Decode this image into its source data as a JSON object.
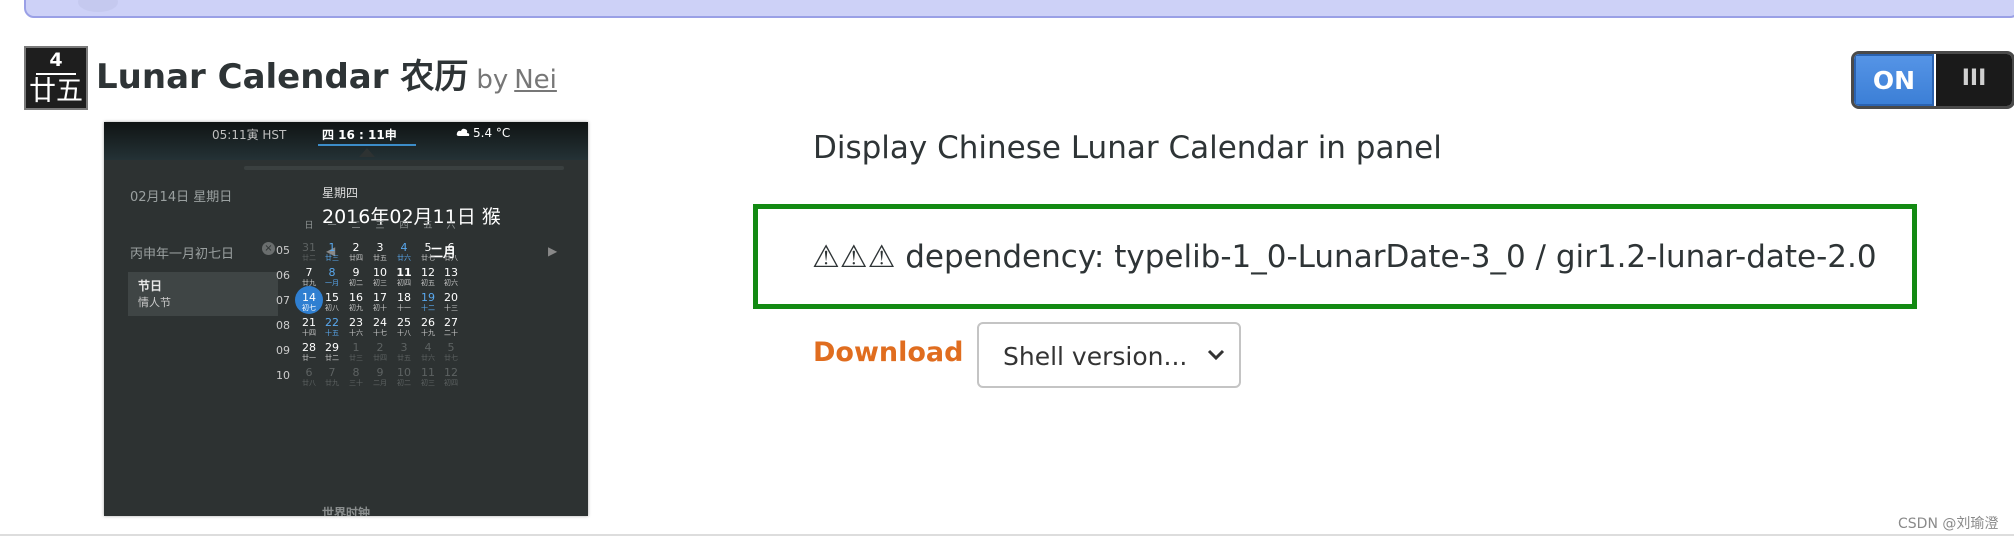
{
  "extension": {
    "icon": {
      "number": "4",
      "lunar_day": "廿五"
    },
    "title": "Lunar Calendar 农历",
    "by": "by",
    "author": "Nei",
    "toggle": {
      "state_label": "ON",
      "handle_glyph": "III",
      "enabled": true
    },
    "description": "Display Chinese Lunar Calendar in panel",
    "dependency": "⚠⚠⚠ dependency: typelib-1_0-LunarDate-3_0 / gir1.2-lunar-date-2.0",
    "download_label": "Download",
    "shell_version_placeholder": "Shell version..."
  },
  "screenshot": {
    "panel": {
      "time_hst": "05:11寅 HST",
      "clock": "四 16 : 11申",
      "weather": "5.4 °C"
    },
    "left_date": "02月14日 星期日",
    "lunar_date": "丙申年一月初七日",
    "close_glyph": "×",
    "festival": {
      "title": "节日",
      "item": "情人节"
    },
    "weekday": "星期四",
    "big_date": "2016年02月11日   猴",
    "nav_prev": "◀",
    "nav_next": "▶",
    "month": "二月",
    "weekday_headers": [
      "日",
      "一",
      "二",
      "三",
      "四",
      "五",
      "六"
    ],
    "weeks": [
      {
        "num": "05",
        "days": [
          {
            "d": "31",
            "l": "廿二",
            "dim": true
          },
          {
            "d": "1",
            "l": "廿三",
            "hl": true
          },
          {
            "d": "2",
            "l": "廿四"
          },
          {
            "d": "3",
            "l": "廿五"
          },
          {
            "d": "4",
            "l": "廿六",
            "hl": true
          },
          {
            "d": "5",
            "l": "廿七"
          },
          {
            "d": "6",
            "l": "廿八"
          }
        ]
      },
      {
        "num": "06",
        "days": [
          {
            "d": "7",
            "l": "廿九"
          },
          {
            "d": "8",
            "l": "一月",
            "hl": true
          },
          {
            "d": "9",
            "l": "初二"
          },
          {
            "d": "10",
            "l": "初三"
          },
          {
            "d": "11",
            "l": "初四",
            "bold": true
          },
          {
            "d": "12",
            "l": "初五"
          },
          {
            "d": "13",
            "l": "初六"
          }
        ]
      },
      {
        "num": "07",
        "days": [
          {
            "d": "14",
            "l": "初七",
            "today": true
          },
          {
            "d": "15",
            "l": "初八"
          },
          {
            "d": "16",
            "l": "初九"
          },
          {
            "d": "17",
            "l": "初十"
          },
          {
            "d": "18",
            "l": "十一"
          },
          {
            "d": "19",
            "l": "十二",
            "hl": true
          },
          {
            "d": "20",
            "l": "十三"
          }
        ]
      },
      {
        "num": "08",
        "days": [
          {
            "d": "21",
            "l": "十四"
          },
          {
            "d": "22",
            "l": "十五",
            "hl": true
          },
          {
            "d": "23",
            "l": "十六"
          },
          {
            "d": "24",
            "l": "十七"
          },
          {
            "d": "25",
            "l": "十八"
          },
          {
            "d": "26",
            "l": "十九"
          },
          {
            "d": "27",
            "l": "二十"
          }
        ]
      },
      {
        "num": "09",
        "days": [
          {
            "d": "28",
            "l": "廿一"
          },
          {
            "d": "29",
            "l": "廿二"
          },
          {
            "d": "1",
            "l": "廿三",
            "dim": true
          },
          {
            "d": "2",
            "l": "廿四",
            "dim": true
          },
          {
            "d": "3",
            "l": "廿五",
            "dim": true
          },
          {
            "d": "4",
            "l": "廿六",
            "dim": true
          },
          {
            "d": "5",
            "l": "廿七",
            "dim": true
          }
        ]
      },
      {
        "num": "10",
        "days": [
          {
            "d": "6",
            "l": "廿八",
            "dim": true
          },
          {
            "d": "7",
            "l": "廿九",
            "dim": true
          },
          {
            "d": "8",
            "l": "三十",
            "dim": true
          },
          {
            "d": "9",
            "l": "二月",
            "dim": true
          },
          {
            "d": "10",
            "l": "初二",
            "dim": true
          },
          {
            "d": "11",
            "l": "初三",
            "dim": true
          },
          {
            "d": "12",
            "l": "初四",
            "dim": true
          }
        ]
      }
    ],
    "bottom_label": "世界时钟"
  },
  "watermark": "CSDN @刘瑜澄",
  "colors": {
    "accent_blue": "#3c7fd6",
    "download_orange": "#e06d1f",
    "dependency_border": "#138a13",
    "today_circle": "#2f7fd1"
  }
}
